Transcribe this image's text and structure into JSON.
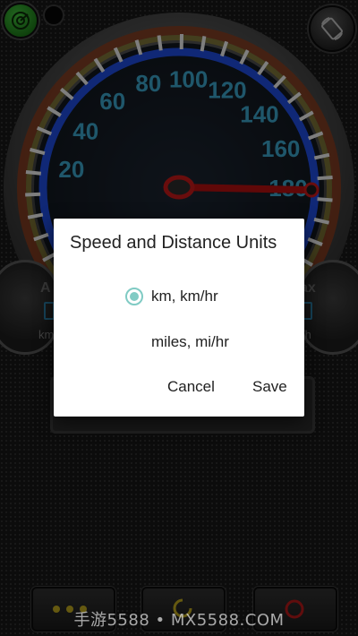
{
  "gauge": {
    "ticks": [
      "20",
      "40",
      "60",
      "80",
      "100",
      "120",
      "140",
      "160",
      "180"
    ],
    "colors": {
      "scale_blue": "#1e49d8",
      "tick_text": "#3a9fc4",
      "needle": "#c01818"
    }
  },
  "pods": {
    "left": {
      "label": "A",
      "unit": "km"
    },
    "right": {
      "label": "ax",
      "unit": "/h"
    }
  },
  "dialog": {
    "title": "Speed and Distance Units",
    "options": [
      {
        "label": "km, km/hr",
        "selected": true
      },
      {
        "label": "miles, mi/hr",
        "selected": false
      }
    ],
    "cancel_label": "Cancel",
    "save_label": "Save",
    "accent": "#80cbc4"
  },
  "icons": {
    "gps": "radar-icon",
    "rotate": "rotate-screen-icon",
    "menu": "more-dots-icon",
    "reset": "reset-icon",
    "power": "power-icon"
  },
  "watermark": "手游5588 • MX5588.COM"
}
